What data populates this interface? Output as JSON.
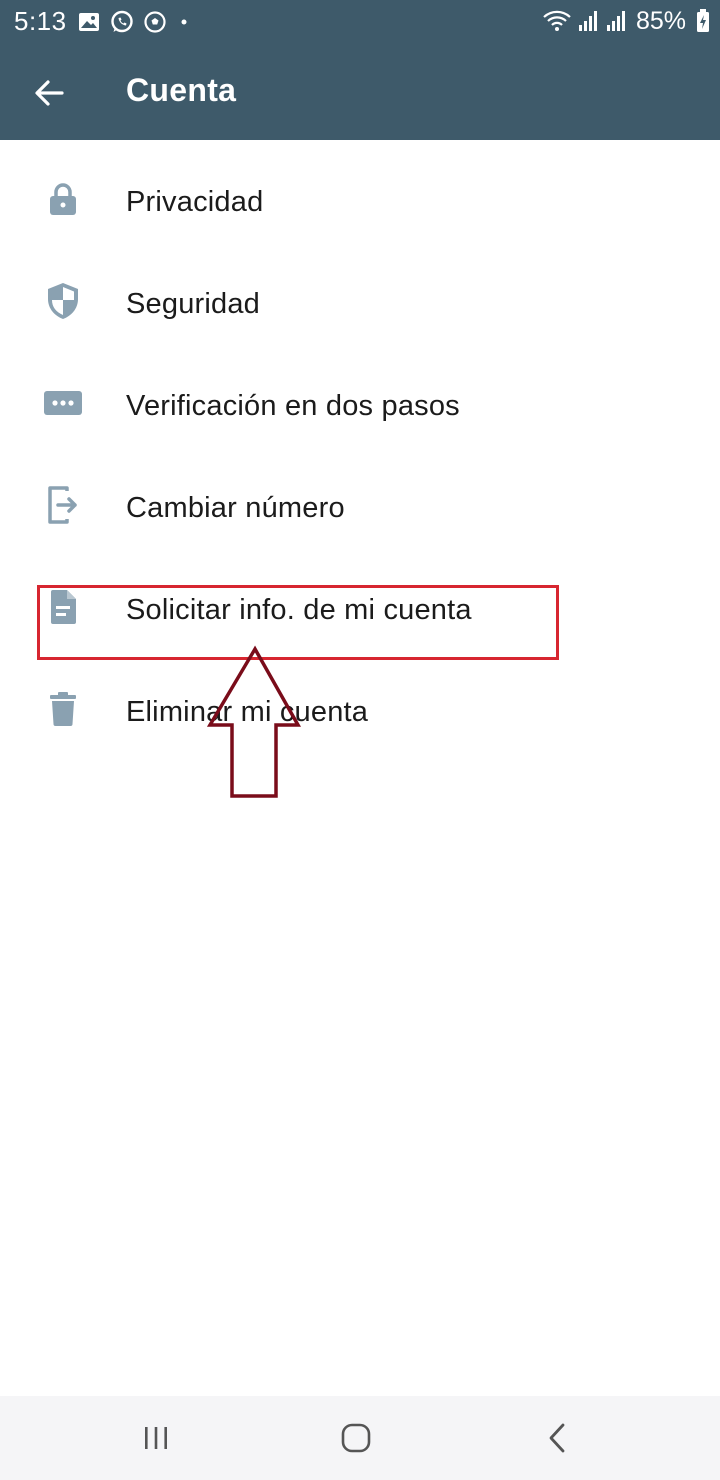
{
  "status_bar": {
    "time": "5:13",
    "battery": "85%",
    "icons_left": [
      "image-icon",
      "whatsapp-icon",
      "soccer-ball-icon",
      "dot-icon"
    ],
    "icons_right": [
      "wifi-icon",
      "signal-icon",
      "signal-icon",
      "battery-charging-icon"
    ]
  },
  "header": {
    "title": "Cuenta",
    "back_icon": "arrow-left-icon",
    "background": "#3e5a6a"
  },
  "menu": {
    "items": [
      {
        "label": "Privacidad",
        "icon": "lock-icon"
      },
      {
        "label": "Seguridad",
        "icon": "shield-icon"
      },
      {
        "label": "Verificación en dos pasos",
        "icon": "dots-icon"
      },
      {
        "label": "Cambiar número",
        "icon": "phone-change-icon"
      },
      {
        "label": "Solicitar info. de mi cuenta",
        "icon": "document-icon"
      },
      {
        "label": "Eliminar mi cuenta",
        "icon": "trash-icon"
      }
    ],
    "icon_color": "#8aa1b1"
  },
  "annotation": {
    "highlight_color": "#d72630",
    "arrow_color": "#7a0c1a"
  },
  "navbar": {
    "buttons": [
      "recent-apps-icon",
      "home-icon",
      "back-icon"
    ]
  }
}
